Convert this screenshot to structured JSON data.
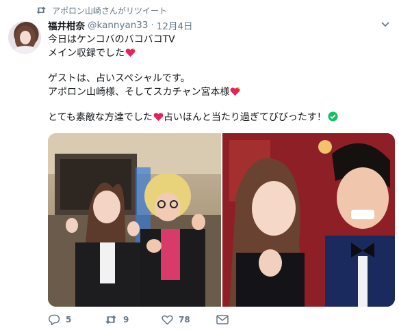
{
  "retweet_banner": {
    "text": "アポロン山崎さんがリツイート",
    "icon": "retweet-icon"
  },
  "author": {
    "name": "福井柑奈",
    "handle": "@kannyan33",
    "separator": "·",
    "time": "12月4日"
  },
  "tweet_lines": {
    "l1": "今日はケンコバのバコバコTV",
    "l2": "メイン収録でした",
    "l3": "ゲストは、占いスペシャルです。",
    "l4": "アポロン山崎様、そしてスカチャン宮本様",
    "l5a": "とても素敵な方達でした",
    "l5b": "占いほんと当たり過ぎてびびったす！"
  },
  "actions": {
    "reply": {
      "icon": "reply-icon",
      "count": "5"
    },
    "retweet": {
      "icon": "retweet-icon",
      "count": "9"
    },
    "like": {
      "icon": "heart-icon",
      "count": "78"
    },
    "dm": {
      "icon": "envelope-icon"
    }
  },
  "colors": {
    "muted": "#657786",
    "text": "#14171a",
    "heart": "#e0245e",
    "check": "#17bf63"
  }
}
